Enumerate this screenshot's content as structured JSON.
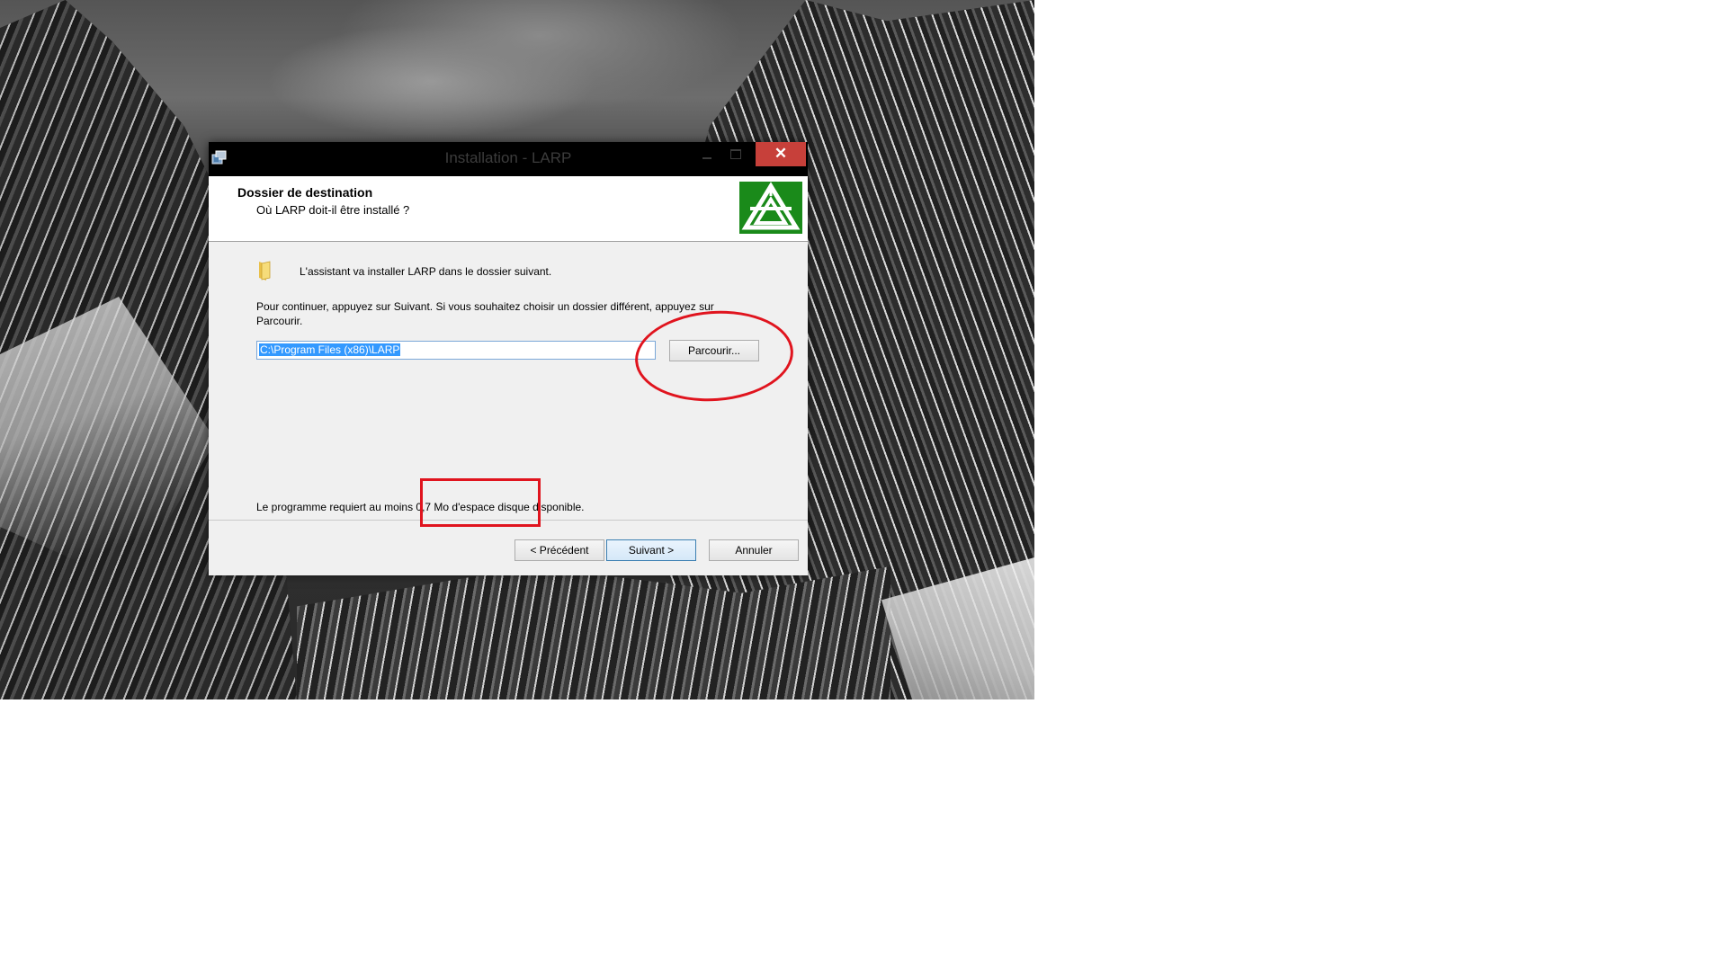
{
  "window": {
    "title": "Installation - LARP",
    "close_glyph": "✕"
  },
  "header": {
    "title": "Dossier de destination",
    "subtitle": "Où LARP doit-il être installé ?",
    "logo_color": "#1a8a1a"
  },
  "body": {
    "intro": "L'assistant va installer LARP dans le dossier suivant.",
    "instructions": "Pour continuer, appuyez sur Suivant. Si vous souhaitez choisir un dossier différent, appuyez sur Parcourir.",
    "path_value": "C:\\Program Files (x86)\\LARP",
    "browse_label": "Parcourir...",
    "space_required": "Le programme requiert au moins 0,7 Mo d'espace disque disponible."
  },
  "footer": {
    "back_label": "< Précédent",
    "next_label": "Suivant >",
    "cancel_label": "Annuler"
  },
  "annotations": {
    "color": "#e0141e"
  }
}
